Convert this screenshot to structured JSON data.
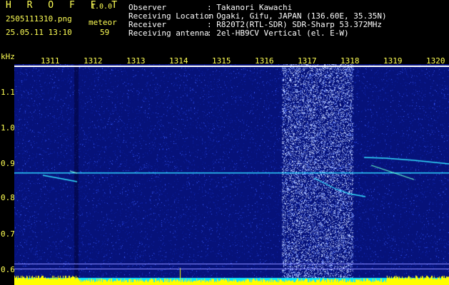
{
  "header": {
    "app_name": "H R O F F T",
    "app_version": "1.0.0",
    "file_name": "2505111310.png",
    "datetime": "25.05.11 13:10",
    "meteor_label": "meteor",
    "meteor_count": "59"
  },
  "info": {
    "observer_key": "Observer",
    "observer_value": ": Takanori Kawachi",
    "location_key": "Receiving Location",
    "location_value": ": Ogaki, Gifu, JAPAN (136.60E, 35.35N)",
    "receiver_key": "Receiver",
    "receiver_value": ": R820T2(RTL-SDR) SDR-Sharp 53.372MHz",
    "antenna_key": "Receiving antenna",
    "antenna_value": ": 2el-HB9CV Vertical (el. E-W)"
  },
  "axis": {
    "y_unit": "kHz",
    "x_ticks": [
      "1311",
      "1312",
      "1313",
      "1314",
      "1315",
      "1316",
      "1317",
      "1318",
      "1319",
      "1320"
    ],
    "y_ticks": [
      "1.1",
      "1.0",
      "0.9",
      "0.8",
      "0.7",
      "0.6"
    ]
  },
  "colors": {
    "text_yellow": "#ffff55",
    "text_white": "#ffffff",
    "background": "#000000",
    "noise_blue": "#0a1a8c",
    "signal_cyan": "#22e0ff",
    "bottom_level": "#ffff00"
  }
}
